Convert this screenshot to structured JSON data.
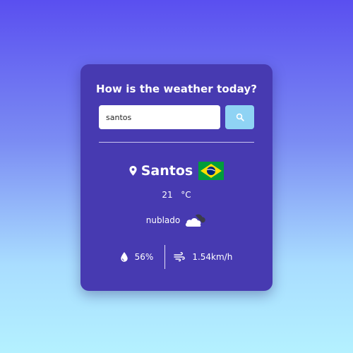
{
  "colors": {
    "card_background": "#473ab1",
    "search_button": "#8fd3f4",
    "text": "#ffffff"
  },
  "header": {
    "title": "How is the weather today?"
  },
  "search": {
    "value": "santos",
    "placeholder": "",
    "button_icon": "search-icon"
  },
  "weather": {
    "location_icon": "map-pin-icon",
    "city": "Santos",
    "country_flag": "brazil-flag-icon",
    "temperature": "21",
    "temperature_unit": "°C",
    "description": "nublado",
    "description_icon": "cloud-icon",
    "humidity_icon": "water-drop-icon",
    "humidity": "56%",
    "wind_icon": "wind-icon",
    "wind_speed": "1.54km/h"
  }
}
